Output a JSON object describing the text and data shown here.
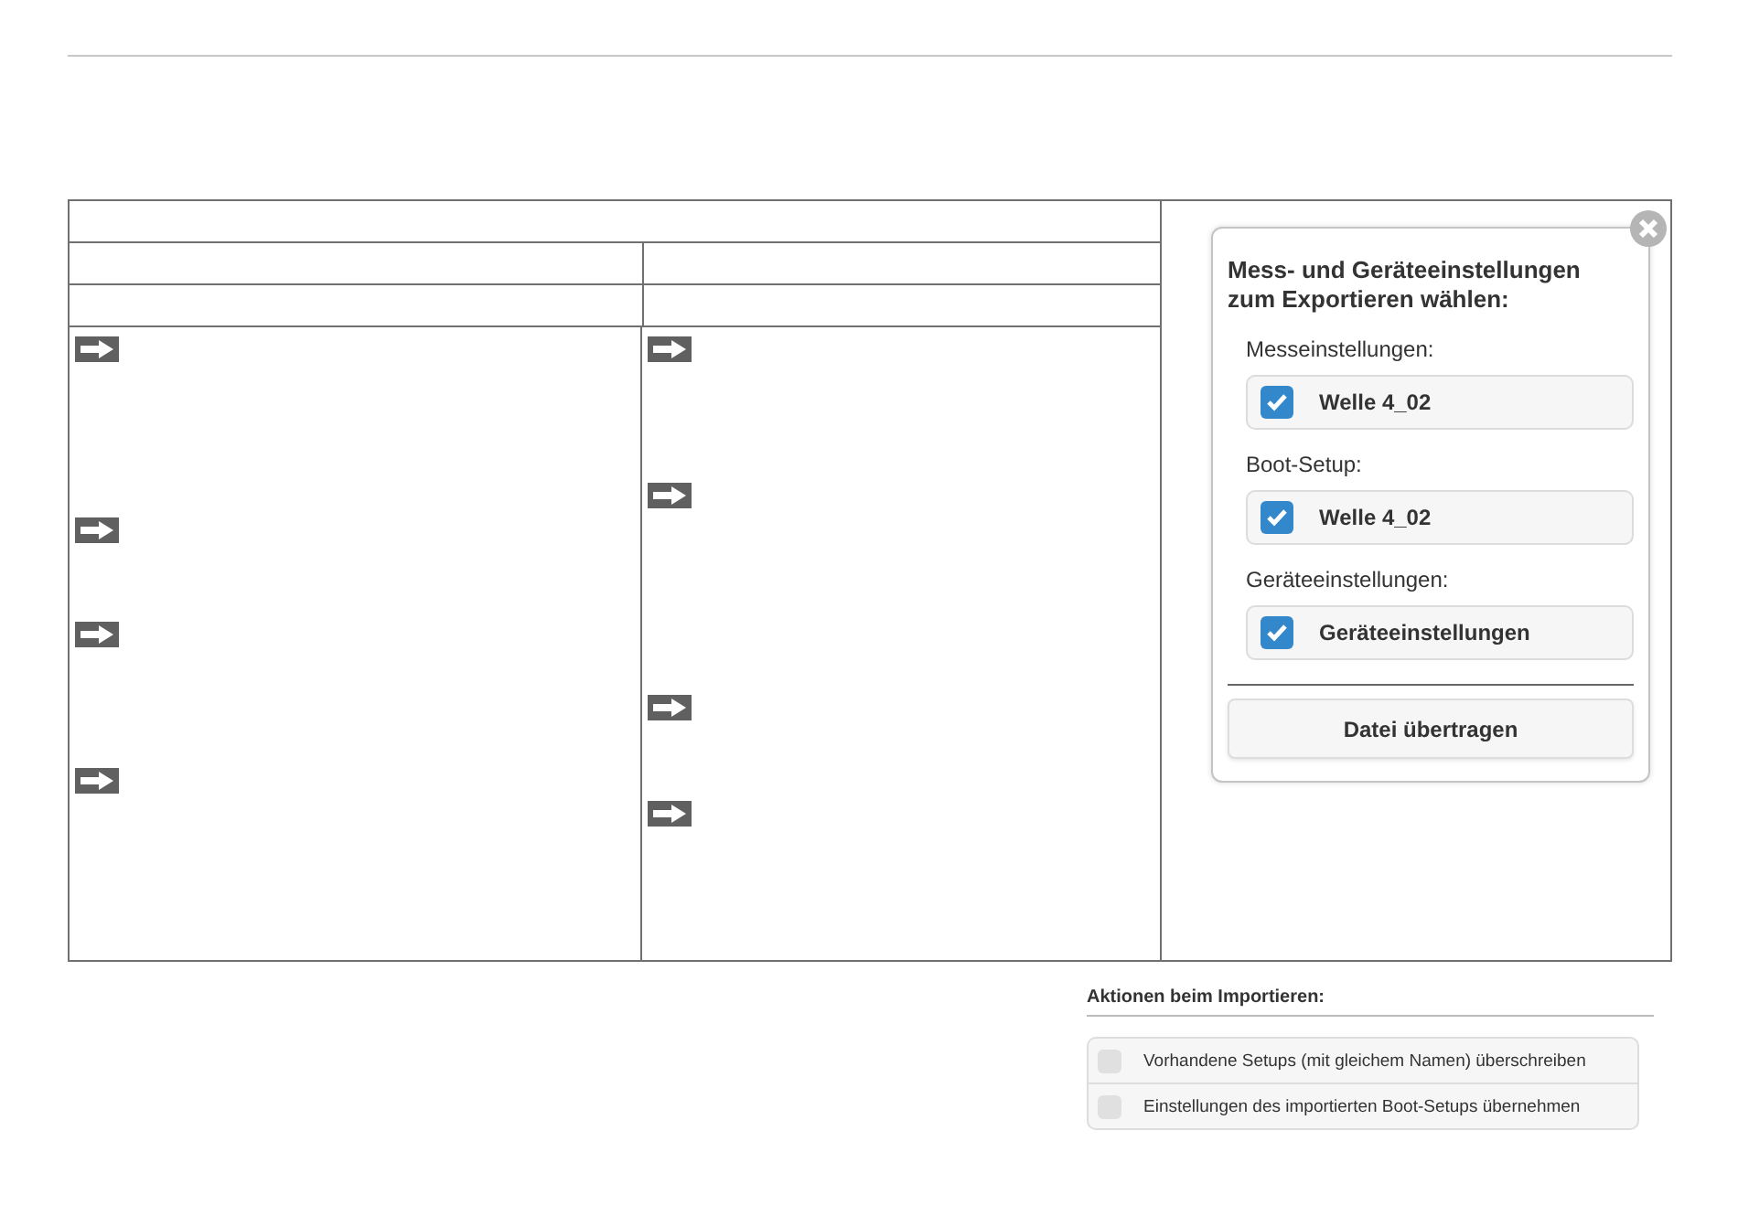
{
  "export_dialog": {
    "title": "Mess- und Geräteeinstellungen zum Exportieren wählen:",
    "groups": [
      {
        "label": "Messeinstellungen:",
        "option": {
          "label": "Welle 4_02",
          "checked": true
        }
      },
      {
        "label": "Boot-Setup:",
        "option": {
          "label": "Welle 4_02",
          "checked": true
        }
      },
      {
        "label": "Geräteeinstellungen:",
        "option": {
          "label": "Geräteeinstellungen",
          "checked": true
        }
      }
    ],
    "button": "Datei übertragen"
  },
  "import_actions": {
    "title": "Aktionen beim Importieren:",
    "options": [
      {
        "label": "Vorhandene Setups (mit gleichem Namen) überschreiben",
        "checked": false
      },
      {
        "label": "Einstellungen des importierten Boot-Setups übernehmen",
        "checked": false
      }
    ]
  }
}
